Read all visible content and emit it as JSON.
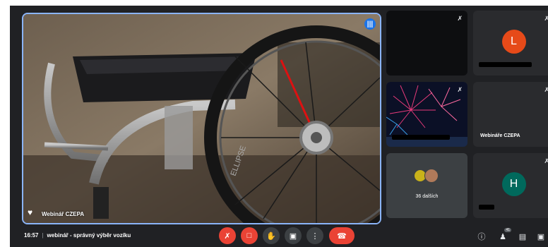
{
  "main_tile": {
    "participant_name": "Webinář CZEPA",
    "wheel_brand_text": "ELLIPSE"
  },
  "side_tiles": [
    {
      "type": "video-black"
    },
    {
      "type": "avatar",
      "initial": "L",
      "avatar_color": "#e64a19"
    },
    {
      "type": "fireworks"
    },
    {
      "type": "name",
      "name": "Webináře CZEPA"
    },
    {
      "type": "others",
      "label": "36 dalších"
    },
    {
      "type": "avatar",
      "initial": "H",
      "avatar_color": "#00695c"
    }
  ],
  "bottom_bar": {
    "time": "16:57",
    "separator": "|",
    "meeting_title": "webinář - správný výběr vozíku",
    "participants_count": "41"
  },
  "controls": [
    {
      "name": "microphone-off",
      "icon": "mic-off-icon"
    },
    {
      "name": "camera-off",
      "icon": "videocam-off-icon"
    },
    {
      "name": "raise-hand",
      "icon": "hand-icon"
    },
    {
      "name": "present-screen",
      "icon": "present-icon"
    },
    {
      "name": "more-options",
      "icon": "more-vert-icon"
    },
    {
      "name": "leave-call",
      "icon": "call-end-icon"
    }
  ],
  "colors": {
    "background": "#202124",
    "active_border": "#8ab4f8",
    "danger": "#ea4335",
    "control_bg": "#3c4043"
  }
}
